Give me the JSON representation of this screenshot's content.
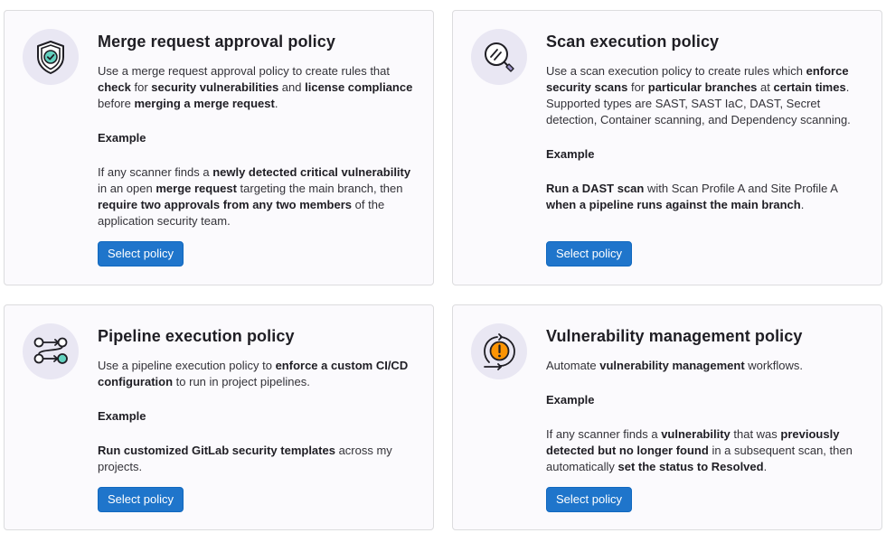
{
  "cards": [
    {
      "icon": "shield-check-icon",
      "title": "Merge request approval policy",
      "description": [
        {
          "t": "Use a merge request approval policy to create rules that ",
          "b": false
        },
        {
          "t": "check",
          "b": true
        },
        {
          "t": " for ",
          "b": false
        },
        {
          "t": "security vulnerabilities",
          "b": true
        },
        {
          "t": " and ",
          "b": false
        },
        {
          "t": "license compliance",
          "b": true
        },
        {
          "t": " before ",
          "b": false
        },
        {
          "t": "merging a merge request",
          "b": true
        },
        {
          "t": ".",
          "b": false
        }
      ],
      "example_heading": "Example",
      "example": [
        {
          "t": "If any scanner finds a ",
          "b": false
        },
        {
          "t": "newly detected critical vulnerability",
          "b": true
        },
        {
          "t": " in an open ",
          "b": false
        },
        {
          "t": "merge request",
          "b": true
        },
        {
          "t": " targeting the main branch, then ",
          "b": false
        },
        {
          "t": "require two approvals from any two members",
          "b": true
        },
        {
          "t": " of the application security team.",
          "b": false
        }
      ],
      "button_label": "Select policy"
    },
    {
      "icon": "scan-magnifier-icon",
      "title": "Scan execution policy",
      "description": [
        {
          "t": "Use a scan execution policy to create rules which ",
          "b": false
        },
        {
          "t": "enforce security scans",
          "b": true
        },
        {
          "t": " for ",
          "b": false
        },
        {
          "t": "particular branches",
          "b": true
        },
        {
          "t": " at ",
          "b": false
        },
        {
          "t": "certain times",
          "b": true
        },
        {
          "t": ". Supported types are SAST, SAST IaC, DAST, Secret detection, Container scanning, and Dependency scanning.",
          "b": false
        }
      ],
      "example_heading": "Example",
      "example": [
        {
          "t": "Run a DAST scan",
          "b": true
        },
        {
          "t": " with Scan Profile A and Site Profile A ",
          "b": false
        },
        {
          "t": "when a pipeline runs against the main branch",
          "b": true
        },
        {
          "t": ".",
          "b": false
        }
      ],
      "button_label": "Select policy"
    },
    {
      "icon": "pipeline-icon",
      "title": "Pipeline execution policy",
      "description": [
        {
          "t": "Use a pipeline execution policy to ",
          "b": false
        },
        {
          "t": "enforce a custom CI/CD configuration",
          "b": true
        },
        {
          "t": " to run in project pipelines.",
          "b": false
        }
      ],
      "example_heading": "Example",
      "example": [
        {
          "t": "Run customized GitLab security templates",
          "b": true
        },
        {
          "t": " across my projects.",
          "b": false
        }
      ],
      "button_label": "Select policy"
    },
    {
      "icon": "vulnerability-cycle-icon",
      "title": "Vulnerability management policy",
      "description": [
        {
          "t": "Automate ",
          "b": false
        },
        {
          "t": "vulnerability management",
          "b": true
        },
        {
          "t": " workflows.",
          "b": false
        }
      ],
      "example_heading": "Example",
      "example": [
        {
          "t": "If any scanner finds a ",
          "b": false
        },
        {
          "t": "vulnerability",
          "b": true
        },
        {
          "t": " that was ",
          "b": false
        },
        {
          "t": "previously detected but no longer found",
          "b": true
        },
        {
          "t": " in a subsequent scan, then automatically ",
          "b": false
        },
        {
          "t": "set the status to Resolved",
          "b": true
        },
        {
          "t": ".",
          "b": false
        }
      ],
      "button_label": "Select policy"
    }
  ],
  "colors": {
    "accent": "#1f75cb",
    "icon_teal": "#63d1bf",
    "icon_orange": "#fc9403",
    "icon_bg": "#e9e7f3"
  }
}
